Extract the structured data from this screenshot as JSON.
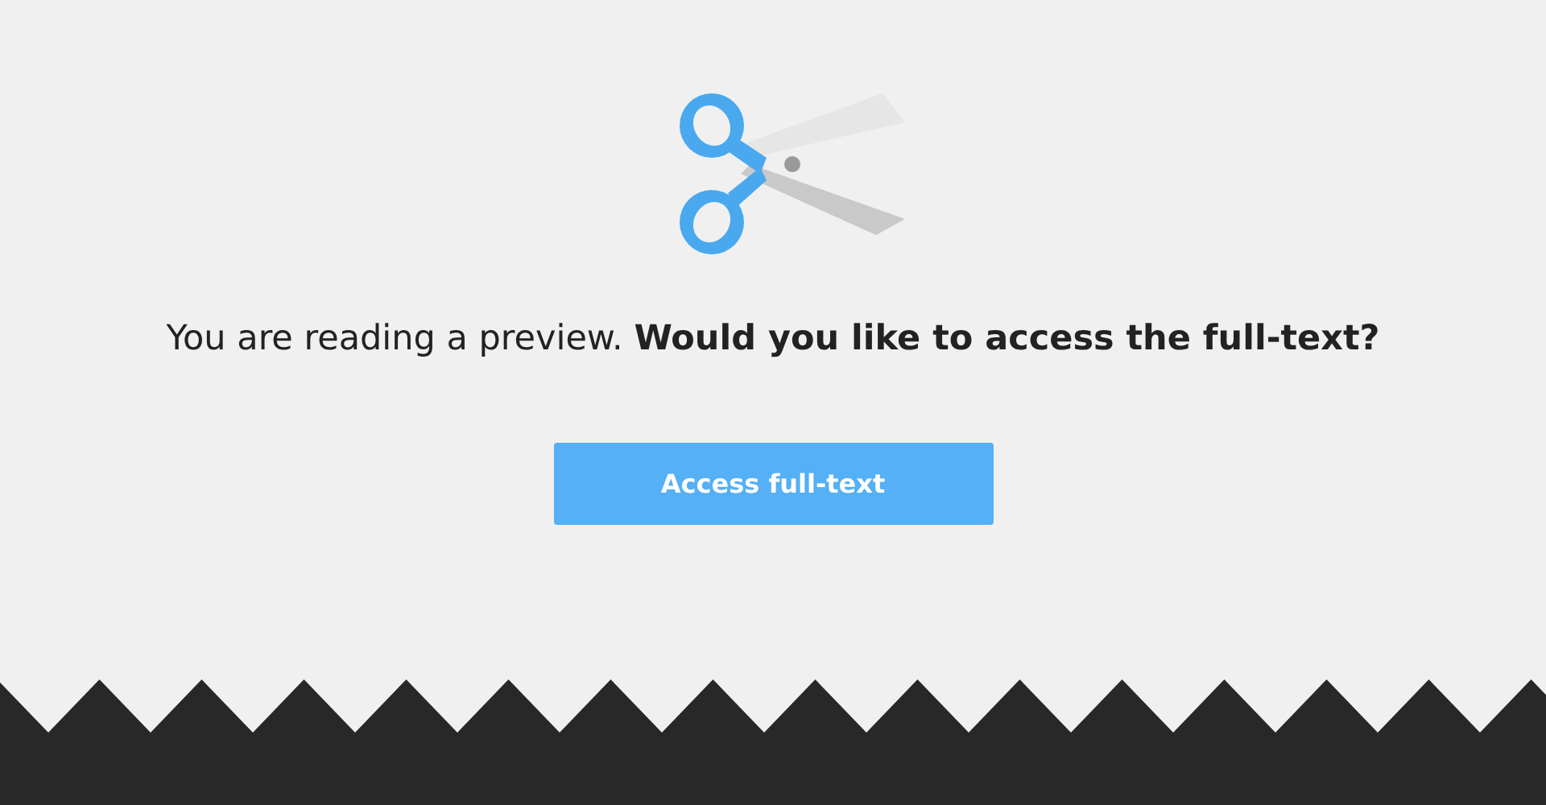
{
  "message": "You are reading a preview. **Would you like to access the full-text?**",
  "button": {
    "label": "Access full-text"
  }
}
